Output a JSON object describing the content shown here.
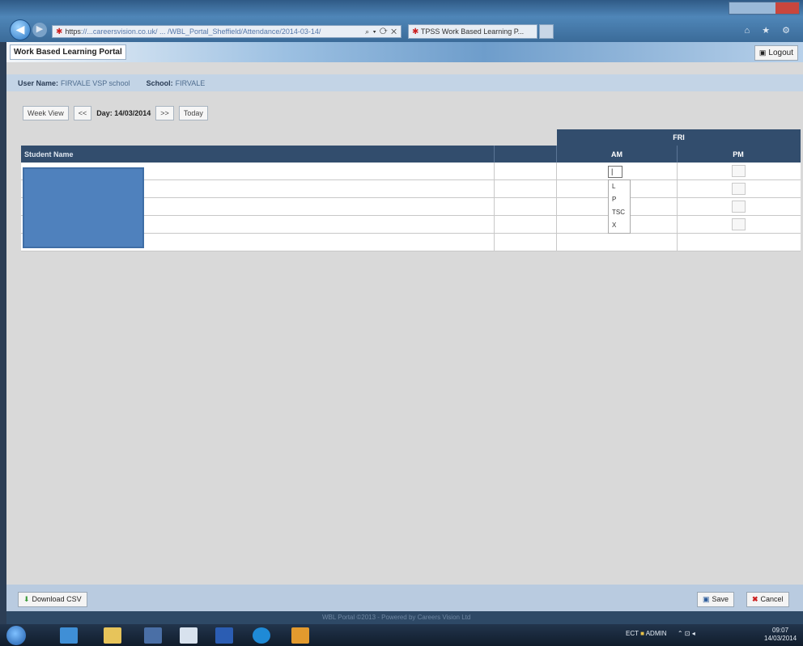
{
  "browser": {
    "address_scheme": "https",
    "address_url": "://...careersvision.co.uk/ ... /WBL_Portal_Sheffield/Attendance/2014-03-14/",
    "tab_title": "TPSS Work Based Learning P...",
    "tab_close": "×"
  },
  "portal": {
    "title": "Work Based Learning Portal",
    "logout_label": "Logout"
  },
  "user_info": {
    "user_name_label": "User Name:",
    "user_name_value": "FIRVALE VSP school",
    "school_label": "School:",
    "school_value": "FIRVALE"
  },
  "date_nav": {
    "week_view_label": "Week View",
    "prev_label": "<<",
    "day_label": "Day:",
    "day_value": "14/03/2014",
    "next_label": ">>",
    "today_label": "Today"
  },
  "grid": {
    "day_header": "FRI",
    "columns": {
      "student_name": "Student Name",
      "am": "AM",
      "pm": "PM"
    },
    "am_input_value": "|",
    "dropdown_options": [
      "L",
      "P",
      "TSC",
      "X"
    ]
  },
  "footer": {
    "download_csv_label": "Download CSV",
    "save_label": "Save",
    "cancel_label": "Cancel",
    "portal_footer_text": "WBL Portal ©2013 - Powered by Careers Vision Ltd"
  },
  "taskbar": {
    "tray_text": "ECT",
    "tray_user": "ADMIN",
    "clock_time": "09:07",
    "clock_date": "14/03/2014"
  }
}
